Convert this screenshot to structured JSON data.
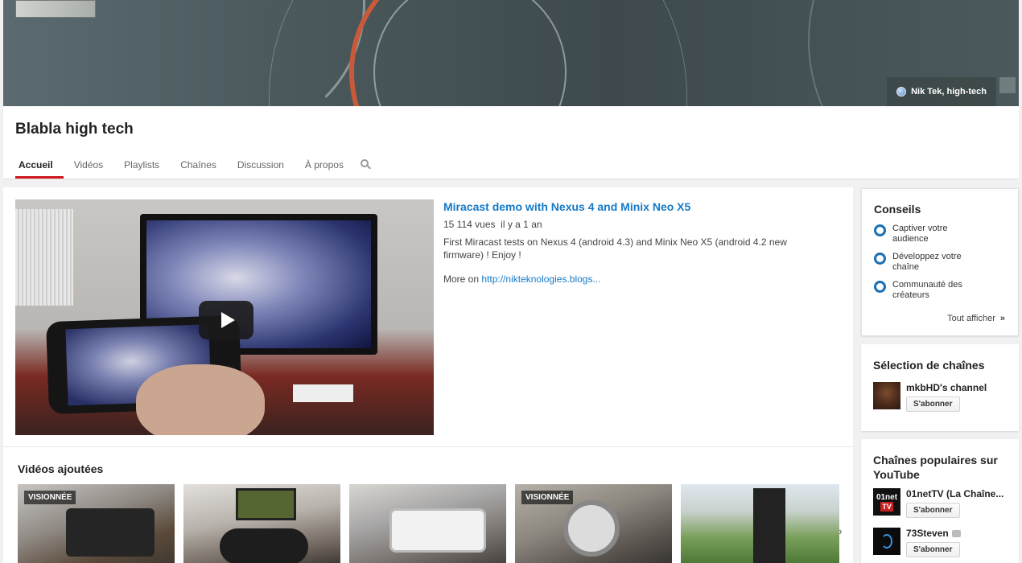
{
  "banner": {
    "link_label": "Nik Tek, high-tech"
  },
  "channel": {
    "title": "Blabla high tech",
    "tabs": [
      {
        "label": "Accueil",
        "active": true
      },
      {
        "label": "Vidéos"
      },
      {
        "label": "Playlists"
      },
      {
        "label": "Chaînes"
      },
      {
        "label": "Discussion"
      },
      {
        "label": "À propos"
      }
    ]
  },
  "featured": {
    "title": "Miracast demo with Nexus 4 and Minix Neo X5",
    "views": "15 114 vues",
    "age": "il y a 1 an",
    "description": "First Miracast tests on Nexus 4 (android 4.3) and Minix Neo X5 (android 4.2 new firmware) ! Enjoy !",
    "more_prefix": "More on",
    "more_link": "http://nikteknologies.blogs..."
  },
  "added": {
    "title": "Vidéos ajoutées",
    "thumbs": [
      {
        "badge": "VISIONNÉE"
      },
      {
        "badge": ""
      },
      {
        "badge": ""
      },
      {
        "badge": "VISIONNÉE"
      },
      {
        "badge": ""
      }
    ]
  },
  "tips": {
    "title": "Conseils",
    "items": [
      {
        "label": "Captiver votre audience"
      },
      {
        "label": "Développez votre chaîne"
      },
      {
        "label": "Communauté des créateurs"
      }
    ],
    "see_all": "Tout afficher",
    "see_all_arrow": "»"
  },
  "featured_channels": {
    "title": "Sélection de chaînes",
    "items": [
      {
        "name": "mkbHD's channel",
        "subscribe": "S'abonner"
      }
    ]
  },
  "popular": {
    "title": "Chaînes populaires sur YouTube",
    "items": [
      {
        "name": "01netTV (La Chaîne...",
        "subscribe": "S'abonner",
        "avatar_text": "01net",
        "avatar_sub": "TV"
      },
      {
        "name": "73Steven",
        "subscribe": "S'abonner",
        "verified": true
      }
    ]
  },
  "colors": {
    "accent_red": "#cc181e",
    "link_blue": "#167ac6",
    "tip_blue": "#1b6fb3"
  }
}
